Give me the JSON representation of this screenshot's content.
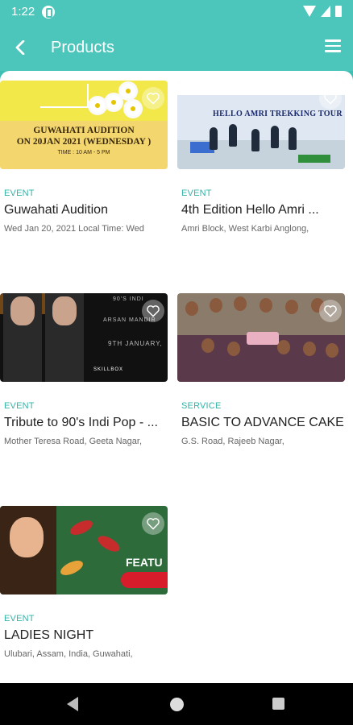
{
  "status": {
    "time": "1:22"
  },
  "app_bar": {
    "title": "Products"
  },
  "products": [
    {
      "type": "EVENT",
      "title": "Guwahati Audition",
      "subtitle": "Wed Jan 20, 2021 Local Time: Wed",
      "image_text": [
        "GUWAHATI AUDITION",
        "ON 20JAN 2021 (WEDNESDAY )",
        "TIME : 10 AM - 5 PM"
      ]
    },
    {
      "type": "EVENT",
      "title": "4th Edition Hello Amri ...",
      "subtitle": "Amri Block, West Karbi Anglong,",
      "image_text": [
        "HELLO AMRI TREKKING TOUR"
      ]
    },
    {
      "type": "EVENT",
      "title": "Tribute to 90's Indi Pop - ...",
      "subtitle": "Mother Teresa Road, Geeta Nagar,",
      "image_text": [
        "90'S INDI",
        "ARSAN MANDIR",
        "9TH JANUARY,",
        "SKILLBOX"
      ]
    },
    {
      "type": "SERVICE",
      "title": "BASIC TO ADVANCE CAKE ...",
      "subtitle": "G.S. Road, Rajeeb Nagar,"
    },
    {
      "type": "EVENT",
      "title": "LADIES NIGHT",
      "subtitle": "Ulubari, Assam, India, Guwahati,",
      "image_text": [
        "FEATU"
      ]
    }
  ],
  "colors": {
    "accent": "#4cc5bb",
    "type_label": "#33b3a8"
  }
}
